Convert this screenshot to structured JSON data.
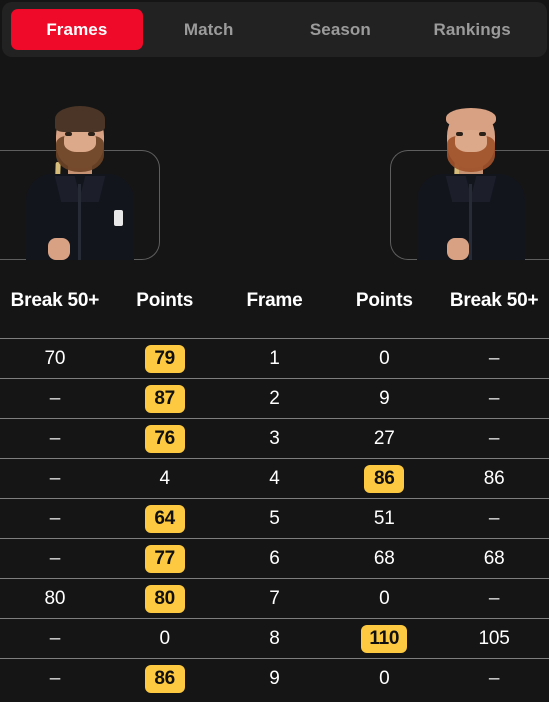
{
  "tabs": [
    {
      "label": "Frames",
      "active": true
    },
    {
      "label": "Match",
      "active": false
    },
    {
      "label": "Season",
      "active": false
    },
    {
      "label": "Rankings",
      "active": false
    }
  ],
  "colors": {
    "background": "#151515",
    "tabbar": "#222222",
    "active_tab": "#EE0A28",
    "badge": "#FCC940",
    "badge_text": "#101010",
    "divider": "#7e7e7e",
    "inactive_tab_text": "#9b9b9b"
  },
  "players": {
    "left": {
      "name": "left-player-photo",
      "appearance": "dark-hair-beard-black-shirt-holding-cue"
    },
    "right": {
      "name": "right-player-photo",
      "appearance": "bald-ginger-beard-black-shirt-holding-cue"
    }
  },
  "table": {
    "headers": [
      "Break 50+",
      "Points",
      "Frame",
      "Points",
      "Break 50+"
    ],
    "rows": [
      {
        "left_break": "70",
        "left_points": "79",
        "left_win": true,
        "frame": "1",
        "right_points": "0",
        "right_win": false,
        "right_break": "–"
      },
      {
        "left_break": "–",
        "left_points": "87",
        "left_win": true,
        "frame": "2",
        "right_points": "9",
        "right_win": false,
        "right_break": "–"
      },
      {
        "left_break": "–",
        "left_points": "76",
        "left_win": true,
        "frame": "3",
        "right_points": "27",
        "right_win": false,
        "right_break": "–"
      },
      {
        "left_break": "–",
        "left_points": "4",
        "left_win": false,
        "frame": "4",
        "right_points": "86",
        "right_win": true,
        "right_break": "86"
      },
      {
        "left_break": "–",
        "left_points": "64",
        "left_win": true,
        "frame": "5",
        "right_points": "51",
        "right_win": false,
        "right_break": "–"
      },
      {
        "left_break": "–",
        "left_points": "77",
        "left_win": true,
        "frame": "6",
        "right_points": "68",
        "right_win": false,
        "right_break": "68"
      },
      {
        "left_break": "80",
        "left_points": "80",
        "left_win": true,
        "frame": "7",
        "right_points": "0",
        "right_win": false,
        "right_break": "–"
      },
      {
        "left_break": "–",
        "left_points": "0",
        "left_win": false,
        "frame": "8",
        "right_points": "110",
        "right_win": true,
        "right_break": "105"
      },
      {
        "left_break": "–",
        "left_points": "86",
        "left_win": true,
        "frame": "9",
        "right_points": "0",
        "right_win": false,
        "right_break": "–"
      }
    ]
  }
}
